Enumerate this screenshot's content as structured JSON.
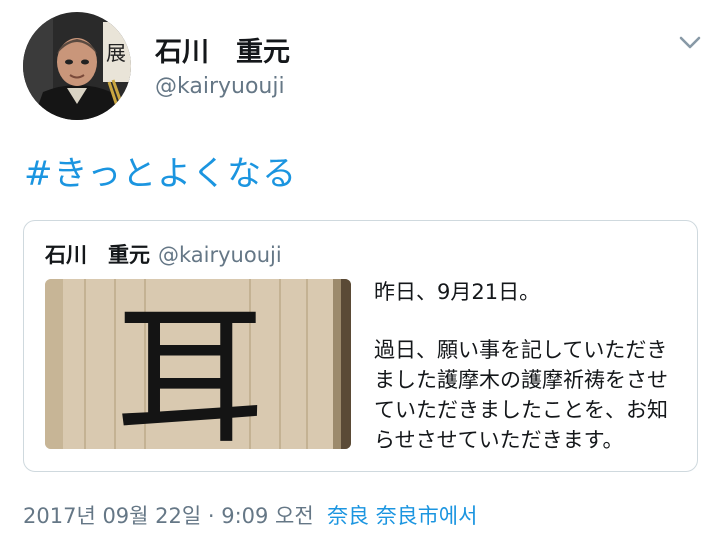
{
  "tweet": {
    "display_name": "石川　重元",
    "handle": "@kairyuouji",
    "hashtag": "#きっとよくなる",
    "timestamp": "2017년 09월 22일 · 9:09 오전",
    "location": "奈良 奈良市",
    "location_suffix": "에서"
  },
  "quoted": {
    "display_name": "石川　重元",
    "handle": "@kairyuouji",
    "text_line1": "昨日、9月21日。",
    "text_body": "過日、願い事を記していただきました護摩木の護摩祈祷をさせていただきましたことを、お知らせさせていただきます。",
    "image_text": "耳"
  },
  "colors": {
    "accent": "#1b95e0",
    "secondary_text": "#657786",
    "border": "#cfd9de"
  },
  "icons": {
    "menu": "chevron-down-icon"
  }
}
